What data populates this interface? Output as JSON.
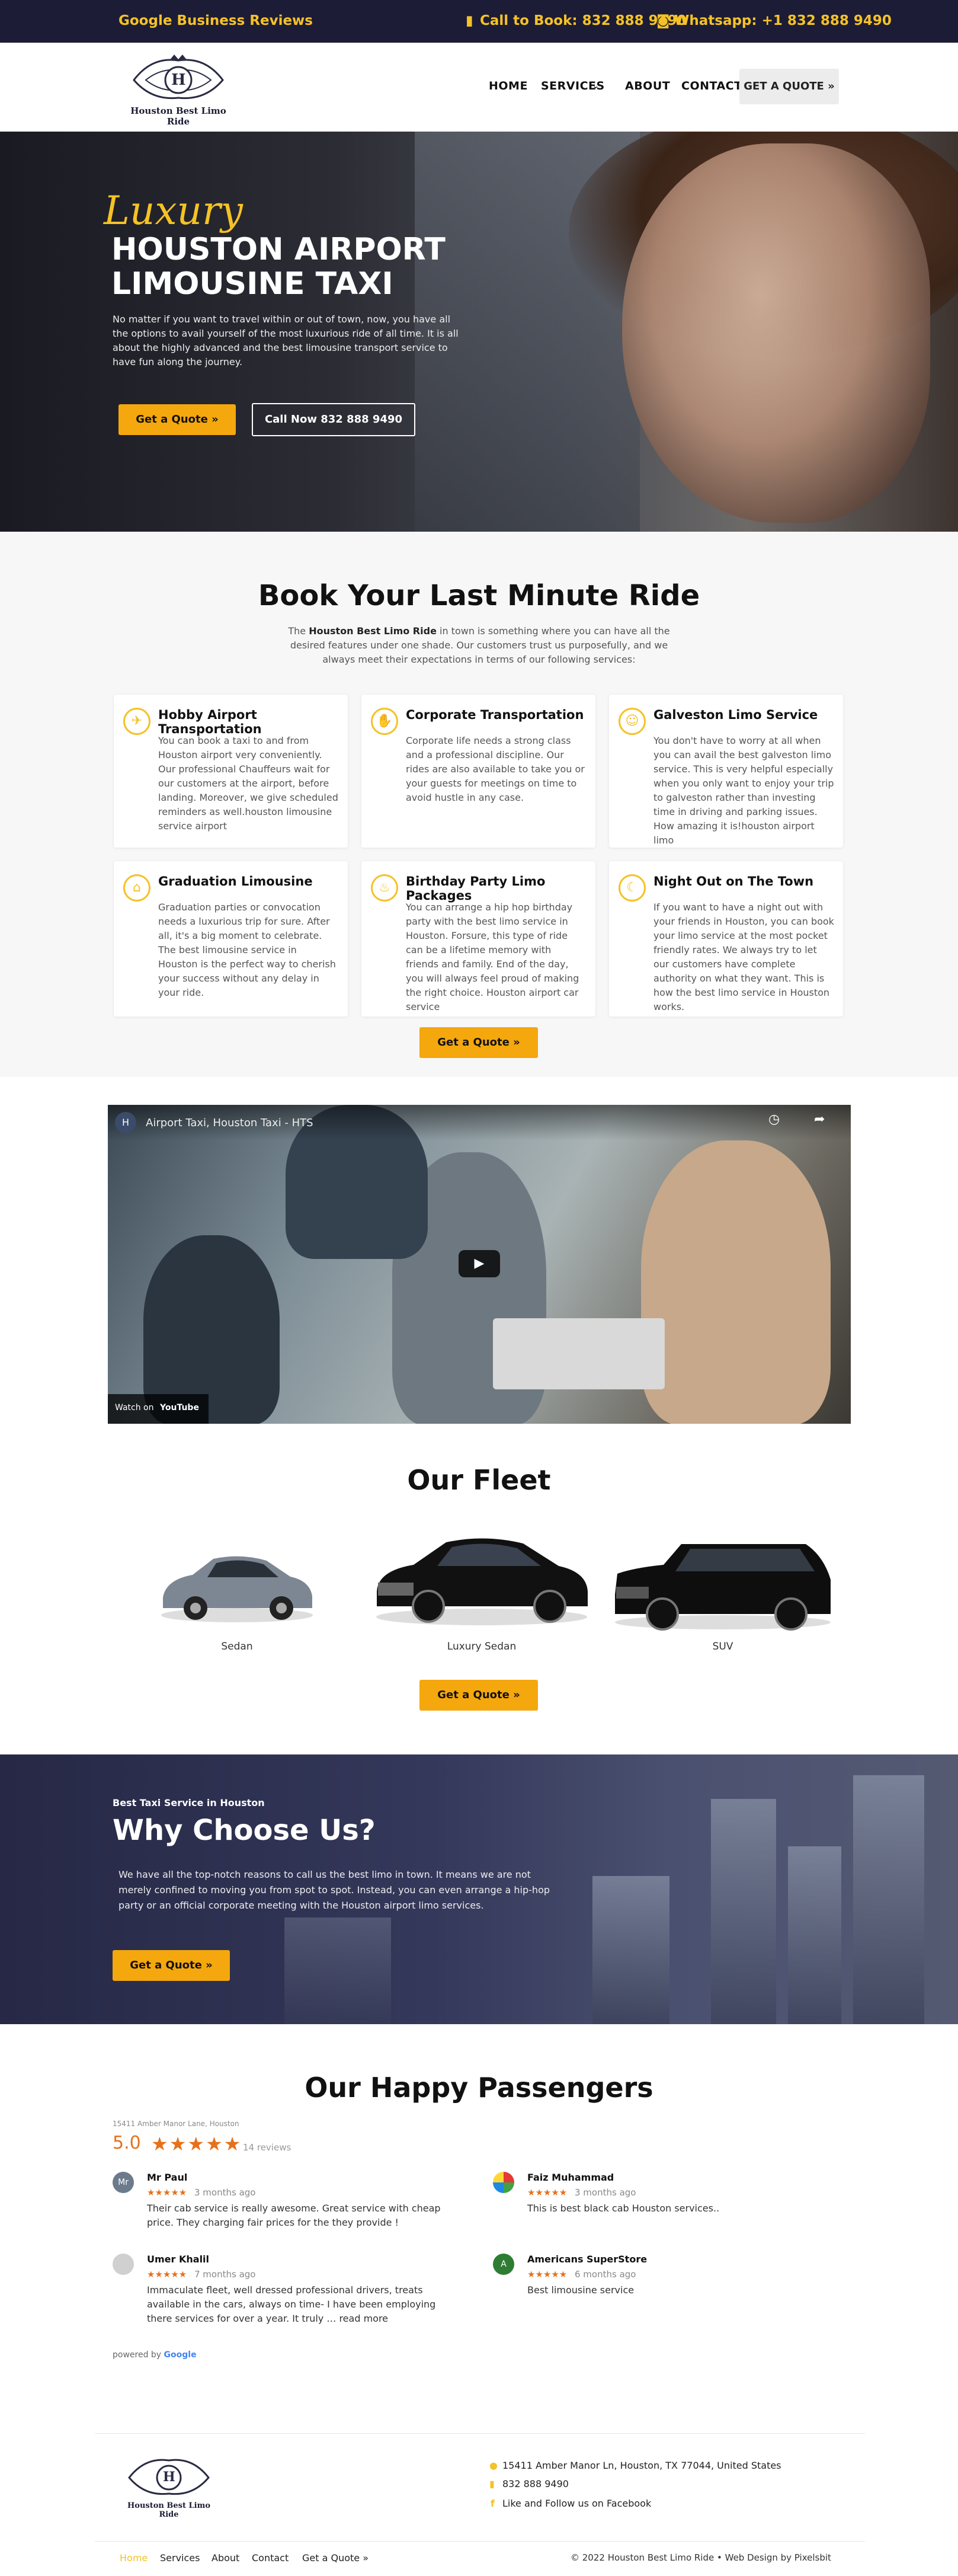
{
  "topbar": {
    "brand_link": "Google Business Reviews",
    "call": "Call to Book: 832 888 9490",
    "whatsapp": "Whatsapp: +1 832 888 9490"
  },
  "header": {
    "logo_text": "Houston Best Limo Ride",
    "logo_letter": "H",
    "nav": [
      "HOME",
      "SERVICES",
      "ABOUT",
      "CONTACT"
    ],
    "quote_button": "GET A QUOTE »"
  },
  "hero": {
    "script_word": "Luxury",
    "title_line1": "HOUSTON AIRPORT",
    "title_line2": "LIMOUSINE TAXI",
    "text": "No matter if you want to travel within or out of town, now, you have all the options to avail yourself of the most luxurious ride of all time. It is all about the highly advanced and the best limousine transport service to have fun along the journey.",
    "btn_quote": "Get a Quote »",
    "btn_call": "Call Now 832 888 9490"
  },
  "book": {
    "title": "Book Your Last Minute Ride",
    "intro_pre": "The ",
    "intro_bold": "Houston Best Limo Ride",
    "intro_post": " in town is something where you can have all the desired features under one shade. Our customers trust us purposefully, and we always meet their expectations in terms of our following services:",
    "cards": [
      {
        "title": "Hobby Airport Transportation",
        "icon": "plane-icon",
        "text": "You can book a taxi to and from Houston airport very conveniently. Our professional Chauffeurs wait for our customers at the airport, before landing. Moreover, we give scheduled reminders as well.houston limousine service airport"
      },
      {
        "title": "Corporate Transportation",
        "icon": "handshake-icon",
        "text": "Corporate life needs a strong class and a professional discipline. Our rides are also available to take you or your guests for meetings on time to avoid hustle in any case."
      },
      {
        "title": "Galveston Limo Service",
        "icon": "person-icon",
        "text": "You don't have to worry at all when you can avail the best galveston limo service. This is very helpful especially when you only want to enjoy your trip to galveston rather than investing time in driving and parking issues. How amazing it is!houston airport limo"
      },
      {
        "title": "Graduation Limousine",
        "icon": "graduation-cap-icon",
        "text": "Graduation parties or convocation needs a luxurious trip for sure. After all, it's a big moment to celebrate. The best limousine service in Houston is the perfect way to cherish your success without any delay in your ride."
      },
      {
        "title": "Birthday Party Limo Packages",
        "icon": "birthday-cake-icon",
        "text": "You can arrange a hip hop birthday party with the best limo service in Houston. Forsure, this type of ride can be a lifetime memory with friends and family. End of the day, you will always feel proud of making the right choice. Houston airport car service"
      },
      {
        "title": "Night Out on The Town",
        "icon": "moon-icon",
        "text": "If you want to have a night out with your friends in Houston, you can book your limo service at the most pocket friendly rates. We always try to let our customers have complete authority on what they want. This is how the best limo service in Houston works."
      }
    ],
    "button": "Get a Quote »"
  },
  "video": {
    "channel_letter": "H",
    "title": "Airport Taxi, Houston Taxi - HTS",
    "watch_on": "Watch on",
    "youtube": "YouTube"
  },
  "fleet": {
    "title": "Our Fleet",
    "cars": [
      "Sedan",
      "Luxury Sedan",
      "SUV"
    ],
    "button": "Get a Quote »"
  },
  "why": {
    "eyebrow": "Best Taxi Service in Houston",
    "title": "Why Choose Us?",
    "text": "We have all the top-notch reasons to call us the best limo in town. It means we are not merely confined to moving you from spot to spot. Instead, you can even arrange a hip-hop party or an official corporate meeting with the Houston airport limo services.",
    "button": "Get a Quote »"
  },
  "reviews": {
    "title": "Our Happy Passengers",
    "address": "15411 Amber Manor Lane, Houston",
    "rating": "5.0",
    "stars": "★★★★★",
    "count": "14 reviews",
    "items": [
      {
        "initials": "Mr",
        "name": "Mr Paul",
        "stars": "★★★★★",
        "time": "3 months ago",
        "text": "Their cab service is really awesome. Great service with cheap price. They charging fair prices for the they provide !",
        "color": "#6b7b8c"
      },
      {
        "initials": "",
        "name": "Faiz Muhammad",
        "stars": "★★★★★",
        "time": "3 months ago",
        "text": "This is best black cab Houston services..",
        "color": "#ffffff"
      },
      {
        "initials": "",
        "name": "Umer Khalil",
        "stars": "★★★★★",
        "time": "7 months ago",
        "text": "Immaculate fleet, well dressed professional drivers, treats available in the cars, always on time- I have been employing there services for over a year. It truly … read more",
        "color": "#d0d0d0"
      },
      {
        "initials": "A",
        "name": "Americans SuperStore",
        "stars": "★★★★★",
        "time": "6 months ago",
        "text": "Best limousine service",
        "color": "#2e7d32"
      }
    ],
    "powered": "powered by",
    "google": "Google"
  },
  "footer": {
    "logo_text": "Houston Best Limo Ride",
    "logo_letter": "H",
    "address": "15411 Amber Manor Ln, Houston, TX 77044, United States",
    "phone": "832 888 9490",
    "facebook": "Like and Follow us on Facebook",
    "links": [
      "Home",
      "Services",
      "About",
      "Contact",
      "Get a Quote »"
    ],
    "copyright": "© 2022 Houston Best Limo Ride • Web Design by Pixelsbit"
  },
  "colors": {
    "navy": "#1c1c36",
    "accent": "#f5c226",
    "button": "#f5a70e"
  }
}
